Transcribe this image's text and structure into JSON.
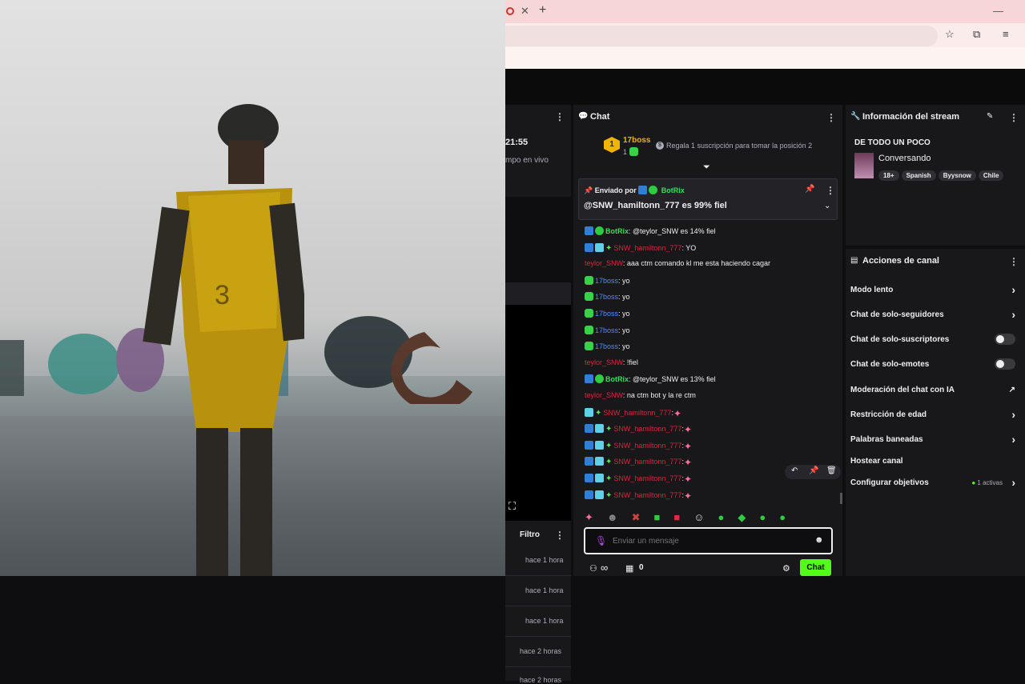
{
  "left_panel": {
    "time_fragment": "21:55",
    "status_fragment": "mpo en vivo",
    "filter_label": "Filtro",
    "times": [
      "hace 1 hora",
      "hace 1 hora",
      "hace 1 hora",
      "hace 2 horas",
      "hace 2 horas"
    ]
  },
  "chat": {
    "title": "Chat",
    "leaderboard": {
      "rank": "1",
      "user": "17boss",
      "count": "1",
      "gift_prompt": "Regala 1 suscripción para tomar la posición 2"
    },
    "pinned": {
      "sent_by_prefix": "Enviado por",
      "sender": "BotRix",
      "text": "@SNW_hamiltonn_777 es 99% fiel"
    },
    "messages": [
      {
        "user": "BotRix",
        "text": ": @teylor_SNW es 14% fiel",
        "color": "green",
        "badges": [
          "blue",
          "green"
        ]
      },
      {
        "user": "SNW_hamiltonn_777",
        "text": ": YO",
        "color": "red",
        "badges": [
          "blue",
          "teal",
          "star"
        ]
      },
      {
        "user": "teylor_SNW",
        "text": ": aaa ctm comando kl me esta haciendo cagar",
        "color": "red",
        "badges": []
      },
      {
        "user": "17boss",
        "text": ": yo",
        "color": "blue",
        "badges": [
          "green2"
        ]
      },
      {
        "user": "17boss",
        "text": ": yo",
        "color": "blue",
        "badges": [
          "green2"
        ]
      },
      {
        "user": "17boss",
        "text": ": yo",
        "color": "blue",
        "badges": [
          "green2"
        ]
      },
      {
        "user": "17boss",
        "text": ": yo",
        "color": "blue",
        "badges": [
          "green2"
        ]
      },
      {
        "user": "17boss",
        "text": ": yo",
        "color": "blue",
        "badges": [
          "green2"
        ]
      },
      {
        "user": "teylor_SNW",
        "text": ": !fiel",
        "color": "red",
        "badges": []
      },
      {
        "user": "BotRix",
        "text": ": @teylor_SNW es 13% fiel",
        "color": "green",
        "badges": [
          "blue",
          "green"
        ]
      },
      {
        "user": "teylor_SNW",
        "text": ": na ctm bot y la re ctm",
        "color": "red",
        "badges": []
      },
      {
        "user": "SNW_hamiltonn_777",
        "text": ":",
        "color": "red",
        "badges": [
          "teal",
          "star"
        ],
        "emote": true
      },
      {
        "user": "SNW_hamiltonn_777",
        "text": ":",
        "color": "red",
        "badges": [
          "blue",
          "teal",
          "star"
        ],
        "emote": true
      },
      {
        "user": "SNW_hamiltonn_777",
        "text": ":",
        "color": "red",
        "badges": [
          "blue",
          "teal",
          "star"
        ],
        "emote": true
      },
      {
        "user": "SNW_hamiltonn_777",
        "text": ":",
        "color": "red",
        "badges": [
          "blue",
          "teal",
          "star"
        ],
        "emote": true
      },
      {
        "user": "SNW_hamiltonn_777",
        "text": ":",
        "color": "red",
        "badges": [
          "blue",
          "teal",
          "star"
        ],
        "emote": true
      },
      {
        "user": "SNW_hamiltonn_777",
        "text": ":",
        "color": "red",
        "badges": [
          "blue",
          "teal",
          "star"
        ],
        "emote": true
      }
    ],
    "input_placeholder": "Enviar un mensaje",
    "footer": {
      "infinity": "∞",
      "points": "0",
      "send_label": "Chat"
    }
  },
  "stream_info": {
    "title": "Información del stream",
    "stream_title": "DE TODO UN POCO",
    "category": "Conversando",
    "tags": [
      "18+",
      "Spanish",
      "Byysnow",
      "Chile"
    ]
  },
  "actions": {
    "title": "Acciones de canal",
    "items": [
      {
        "label": "Modo lento",
        "control": "chevron"
      },
      {
        "label": "Chat de solo-seguidores",
        "control": "chevron"
      },
      {
        "label": "Chat de solo-suscriptores",
        "control": "toggle"
      },
      {
        "label": "Chat de solo-emotes",
        "control": "toggle"
      },
      {
        "label": "Moderación del chat con IA",
        "control": "external"
      },
      {
        "label": "Restricción de edad",
        "control": "chevron"
      },
      {
        "label": "Palabras baneadas",
        "control": "chevron"
      },
      {
        "label": "Hostear canal",
        "control": "none"
      },
      {
        "label": "Configurar objetivos",
        "control": "chevron",
        "extra": "1 activas"
      }
    ]
  },
  "colors": {
    "accent_green": "#53fc18",
    "user_red": "#d8263c",
    "user_blue": "#4b8cff",
    "bot_green": "#35e05a",
    "gold": "#f0b400"
  }
}
